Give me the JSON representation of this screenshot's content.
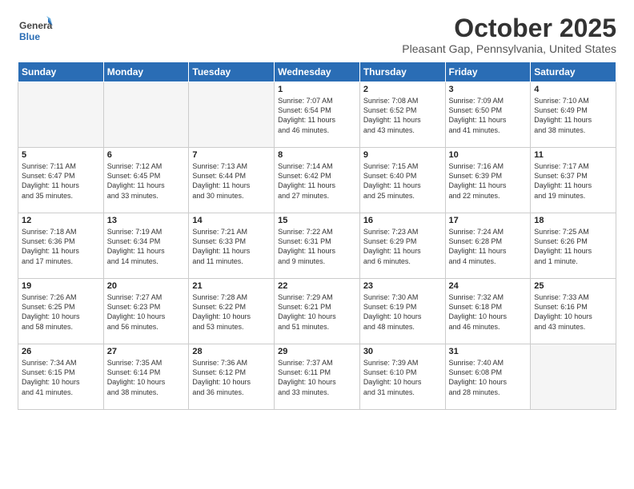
{
  "logo": {
    "general": "General",
    "blue": "Blue"
  },
  "header": {
    "month": "October 2025",
    "location": "Pleasant Gap, Pennsylvania, United States"
  },
  "weekdays": [
    "Sunday",
    "Monday",
    "Tuesday",
    "Wednesday",
    "Thursday",
    "Friday",
    "Saturday"
  ],
  "weeks": [
    [
      {
        "day": "",
        "empty": true
      },
      {
        "day": "",
        "empty": true
      },
      {
        "day": "",
        "empty": true
      },
      {
        "day": "1",
        "info": "Sunrise: 7:07 AM\nSunset: 6:54 PM\nDaylight: 11 hours\nand 46 minutes."
      },
      {
        "day": "2",
        "info": "Sunrise: 7:08 AM\nSunset: 6:52 PM\nDaylight: 11 hours\nand 43 minutes."
      },
      {
        "day": "3",
        "info": "Sunrise: 7:09 AM\nSunset: 6:50 PM\nDaylight: 11 hours\nand 41 minutes."
      },
      {
        "day": "4",
        "info": "Sunrise: 7:10 AM\nSunset: 6:49 PM\nDaylight: 11 hours\nand 38 minutes."
      }
    ],
    [
      {
        "day": "5",
        "info": "Sunrise: 7:11 AM\nSunset: 6:47 PM\nDaylight: 11 hours\nand 35 minutes."
      },
      {
        "day": "6",
        "info": "Sunrise: 7:12 AM\nSunset: 6:45 PM\nDaylight: 11 hours\nand 33 minutes."
      },
      {
        "day": "7",
        "info": "Sunrise: 7:13 AM\nSunset: 6:44 PM\nDaylight: 11 hours\nand 30 minutes."
      },
      {
        "day": "8",
        "info": "Sunrise: 7:14 AM\nSunset: 6:42 PM\nDaylight: 11 hours\nand 27 minutes."
      },
      {
        "day": "9",
        "info": "Sunrise: 7:15 AM\nSunset: 6:40 PM\nDaylight: 11 hours\nand 25 minutes."
      },
      {
        "day": "10",
        "info": "Sunrise: 7:16 AM\nSunset: 6:39 PM\nDaylight: 11 hours\nand 22 minutes."
      },
      {
        "day": "11",
        "info": "Sunrise: 7:17 AM\nSunset: 6:37 PM\nDaylight: 11 hours\nand 19 minutes."
      }
    ],
    [
      {
        "day": "12",
        "info": "Sunrise: 7:18 AM\nSunset: 6:36 PM\nDaylight: 11 hours\nand 17 minutes."
      },
      {
        "day": "13",
        "info": "Sunrise: 7:19 AM\nSunset: 6:34 PM\nDaylight: 11 hours\nand 14 minutes."
      },
      {
        "day": "14",
        "info": "Sunrise: 7:21 AM\nSunset: 6:33 PM\nDaylight: 11 hours\nand 11 minutes."
      },
      {
        "day": "15",
        "info": "Sunrise: 7:22 AM\nSunset: 6:31 PM\nDaylight: 11 hours\nand 9 minutes."
      },
      {
        "day": "16",
        "info": "Sunrise: 7:23 AM\nSunset: 6:29 PM\nDaylight: 11 hours\nand 6 minutes."
      },
      {
        "day": "17",
        "info": "Sunrise: 7:24 AM\nSunset: 6:28 PM\nDaylight: 11 hours\nand 4 minutes."
      },
      {
        "day": "18",
        "info": "Sunrise: 7:25 AM\nSunset: 6:26 PM\nDaylight: 11 hours\nand 1 minute."
      }
    ],
    [
      {
        "day": "19",
        "info": "Sunrise: 7:26 AM\nSunset: 6:25 PM\nDaylight: 10 hours\nand 58 minutes."
      },
      {
        "day": "20",
        "info": "Sunrise: 7:27 AM\nSunset: 6:23 PM\nDaylight: 10 hours\nand 56 minutes."
      },
      {
        "day": "21",
        "info": "Sunrise: 7:28 AM\nSunset: 6:22 PM\nDaylight: 10 hours\nand 53 minutes."
      },
      {
        "day": "22",
        "info": "Sunrise: 7:29 AM\nSunset: 6:21 PM\nDaylight: 10 hours\nand 51 minutes."
      },
      {
        "day": "23",
        "info": "Sunrise: 7:30 AM\nSunset: 6:19 PM\nDaylight: 10 hours\nand 48 minutes."
      },
      {
        "day": "24",
        "info": "Sunrise: 7:32 AM\nSunset: 6:18 PM\nDaylight: 10 hours\nand 46 minutes."
      },
      {
        "day": "25",
        "info": "Sunrise: 7:33 AM\nSunset: 6:16 PM\nDaylight: 10 hours\nand 43 minutes."
      }
    ],
    [
      {
        "day": "26",
        "info": "Sunrise: 7:34 AM\nSunset: 6:15 PM\nDaylight: 10 hours\nand 41 minutes."
      },
      {
        "day": "27",
        "info": "Sunrise: 7:35 AM\nSunset: 6:14 PM\nDaylight: 10 hours\nand 38 minutes."
      },
      {
        "day": "28",
        "info": "Sunrise: 7:36 AM\nSunset: 6:12 PM\nDaylight: 10 hours\nand 36 minutes."
      },
      {
        "day": "29",
        "info": "Sunrise: 7:37 AM\nSunset: 6:11 PM\nDaylight: 10 hours\nand 33 minutes."
      },
      {
        "day": "30",
        "info": "Sunrise: 7:39 AM\nSunset: 6:10 PM\nDaylight: 10 hours\nand 31 minutes."
      },
      {
        "day": "31",
        "info": "Sunrise: 7:40 AM\nSunset: 6:08 PM\nDaylight: 10 hours\nand 28 minutes."
      },
      {
        "day": "",
        "empty": true
      }
    ]
  ]
}
